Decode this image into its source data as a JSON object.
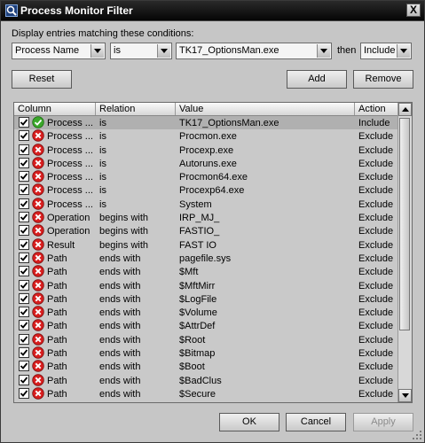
{
  "window": {
    "title": "Process Monitor Filter",
    "close_label": "X"
  },
  "filter": {
    "prompt": "Display entries matching these conditions:",
    "column_value": "Process Name",
    "relation_value": "is",
    "value_value": "TK17_OptionsMan.exe",
    "then_label": "then",
    "action_value": "Include"
  },
  "buttons": {
    "reset": "Reset",
    "add": "Add",
    "remove": "Remove",
    "ok": "OK",
    "cancel": "Cancel",
    "apply": "Apply"
  },
  "table": {
    "headers": {
      "column": "Column",
      "relation": "Relation",
      "value": "Value",
      "action": "Action"
    },
    "rows": [
      {
        "column": "Process ...",
        "relation": "is",
        "value": "TK17_OptionsMan.exe",
        "action": "Include",
        "type": "include"
      },
      {
        "column": "Process ...",
        "relation": "is",
        "value": "Procmon.exe",
        "action": "Exclude",
        "type": "exclude"
      },
      {
        "column": "Process ...",
        "relation": "is",
        "value": "Procexp.exe",
        "action": "Exclude",
        "type": "exclude"
      },
      {
        "column": "Process ...",
        "relation": "is",
        "value": "Autoruns.exe",
        "action": "Exclude",
        "type": "exclude"
      },
      {
        "column": "Process ...",
        "relation": "is",
        "value": "Procmon64.exe",
        "action": "Exclude",
        "type": "exclude"
      },
      {
        "column": "Process ...",
        "relation": "is",
        "value": "Procexp64.exe",
        "action": "Exclude",
        "type": "exclude"
      },
      {
        "column": "Process ...",
        "relation": "is",
        "value": "System",
        "action": "Exclude",
        "type": "exclude"
      },
      {
        "column": "Operation",
        "relation": "begins with",
        "value": "IRP_MJ_",
        "action": "Exclude",
        "type": "exclude"
      },
      {
        "column": "Operation",
        "relation": "begins with",
        "value": "FASTIO_",
        "action": "Exclude",
        "type": "exclude"
      },
      {
        "column": "Result",
        "relation": "begins with",
        "value": "FAST IO",
        "action": "Exclude",
        "type": "exclude"
      },
      {
        "column": "Path",
        "relation": "ends with",
        "value": "pagefile.sys",
        "action": "Exclude",
        "type": "exclude"
      },
      {
        "column": "Path",
        "relation": "ends with",
        "value": "$Mft",
        "action": "Exclude",
        "type": "exclude"
      },
      {
        "column": "Path",
        "relation": "ends with",
        "value": "$MftMirr",
        "action": "Exclude",
        "type": "exclude"
      },
      {
        "column": "Path",
        "relation": "ends with",
        "value": "$LogFile",
        "action": "Exclude",
        "type": "exclude"
      },
      {
        "column": "Path",
        "relation": "ends with",
        "value": "$Volume",
        "action": "Exclude",
        "type": "exclude"
      },
      {
        "column": "Path",
        "relation": "ends with",
        "value": "$AttrDef",
        "action": "Exclude",
        "type": "exclude"
      },
      {
        "column": "Path",
        "relation": "ends with",
        "value": "$Root",
        "action": "Exclude",
        "type": "exclude"
      },
      {
        "column": "Path",
        "relation": "ends with",
        "value": "$Bitmap",
        "action": "Exclude",
        "type": "exclude"
      },
      {
        "column": "Path",
        "relation": "ends with",
        "value": "$Boot",
        "action": "Exclude",
        "type": "exclude"
      },
      {
        "column": "Path",
        "relation": "ends with",
        "value": "$BadClus",
        "action": "Exclude",
        "type": "exclude"
      },
      {
        "column": "Path",
        "relation": "ends with",
        "value": "$Secure",
        "action": "Exclude",
        "type": "exclude"
      }
    ]
  },
  "icons": {
    "include": "green-check-icon",
    "exclude": "red-x-icon",
    "checkbox": "checkmark-icon"
  },
  "colors": {
    "include_icon": "#3aa82a",
    "exclude_icon": "#d81e1e",
    "selected_row": "#b0b0b0"
  }
}
